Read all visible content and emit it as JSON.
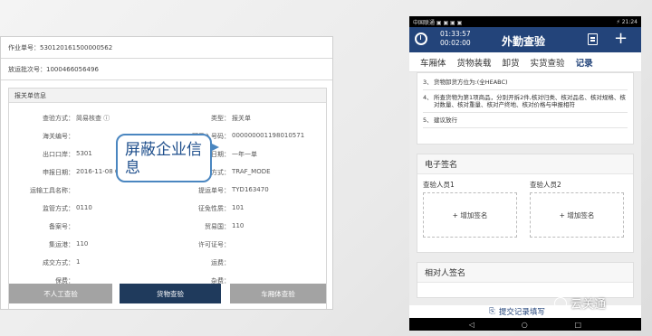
{
  "left": {
    "work_no": "作业单号：530120161500000562",
    "batch_no": "放运批次号：1000466056496",
    "form_title": "报关单信息",
    "fields": [
      {
        "label": "查验方式：",
        "value": "简易核查 ⓘ"
      },
      {
        "label": "类型：",
        "value": "报关单"
      },
      {
        "label": "海关编号：",
        "value": ""
      },
      {
        "label": "预录入号码：",
        "value": "000000001198010571"
      },
      {
        "label": "出口口岸：",
        "value": "5301"
      },
      {
        "label": "出口日期：",
        "value": "一年一单"
      },
      {
        "label": "申报日期：",
        "value": "2016-11-08 00:0"
      },
      {
        "label": "运输方式：",
        "value": "TRAF_MODE"
      },
      {
        "label": "运输工具名称：",
        "value": ""
      },
      {
        "label": "提运单号：",
        "value": "TYD163470"
      },
      {
        "label": "监管方式：",
        "value": "0110"
      },
      {
        "label": "征免性质：",
        "value": "101"
      },
      {
        "label": "备案号：",
        "value": ""
      },
      {
        "label": "贸易国：",
        "value": "110"
      },
      {
        "label": "集运港：",
        "value": "110"
      },
      {
        "label": "许可证号：",
        "value": ""
      },
      {
        "label": "成交方式：",
        "value": "1"
      },
      {
        "label": "运费：",
        "value": ""
      },
      {
        "label": "保费：",
        "value": ""
      },
      {
        "label": "杂费：",
        "value": ""
      }
    ],
    "callout": "屏蔽企业信息",
    "buttons": [
      "不人工查验",
      "货物查验",
      "车厢体查验"
    ]
  },
  "phone": {
    "status_left": "中国联通 ▣ ▣ ▣ ▣",
    "status_right": "⚡ 21:24",
    "time1": "01:33:57",
    "time2": "00:02:00",
    "title": "外勤查验",
    "tabs": [
      "车厢体",
      "货物装载",
      "卸货",
      "实货查验",
      "记录"
    ],
    "items": [
      {
        "num": "3、",
        "text": "货物卸货方位为:(全HEABC)"
      },
      {
        "num": "4、",
        "text": "所查货物为第1项商品，分别开拆2件,核对归类、核对品名、核对规格、核对数量、核对重量、核对产终地、核对价格与申报相符"
      },
      {
        "num": "5、",
        "text": "建议放行"
      }
    ],
    "esign_title": "电子签名",
    "signer1": "查验人员1",
    "signer2": "查验人员2",
    "add_sign": "+ 增加签名",
    "party_title": "相对人签名",
    "submit": "提交记录填写",
    "nav": [
      "◁",
      "○",
      "□"
    ]
  },
  "watermark": "云关通"
}
